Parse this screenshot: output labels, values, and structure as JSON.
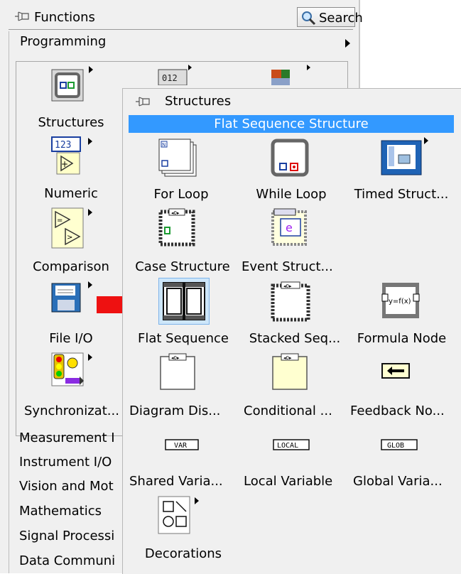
{
  "functions_palette": {
    "title": "Functions",
    "search_label": "Search",
    "programming_label": "Programming",
    "categories": [
      {
        "label": "Structures",
        "icon": "structures-icon"
      },
      {
        "label": "Numeric",
        "icon": "numeric-icon"
      },
      {
        "label": "Comparison",
        "icon": "comparison-icon"
      },
      {
        "label": "File I/O",
        "icon": "file-io-icon"
      },
      {
        "label": "Synchronizat...",
        "icon": "synchronization-icon"
      }
    ],
    "list_items": [
      "Measurement I",
      "Instrument I/O",
      "Vision and Mot",
      "Mathematics",
      "Signal Processi",
      "Data Communi"
    ]
  },
  "structures_palette": {
    "title": "Structures",
    "selected_item_header": "Flat Sequence Structure",
    "items": [
      {
        "label": "For Loop",
        "icon": "for-loop-icon"
      },
      {
        "label": "While Loop",
        "icon": "while-loop-icon"
      },
      {
        "label": "Timed Struct...",
        "icon": "timed-structure-icon"
      },
      {
        "label": "Case Structure",
        "icon": "case-structure-icon"
      },
      {
        "label": "Event Struct...",
        "icon": "event-structure-icon"
      },
      {
        "label": "Flat Sequence",
        "icon": "flat-sequence-icon"
      },
      {
        "label": "Stacked Seq...",
        "icon": "stacked-sequence-icon"
      },
      {
        "label": "Formula Node",
        "icon": "formula-node-icon"
      },
      {
        "label": "Diagram Dis...",
        "icon": "diagram-disable-icon"
      },
      {
        "label": "Conditional ...",
        "icon": "conditional-disable-icon"
      },
      {
        "label": "Feedback No...",
        "icon": "feedback-node-icon"
      },
      {
        "label": "Shared Varia...",
        "icon": "shared-variable-icon"
      },
      {
        "label": "Local Variable",
        "icon": "local-variable-icon"
      },
      {
        "label": "Global Varia...",
        "icon": "global-variable-icon"
      },
      {
        "label": "Decorations",
        "icon": "decorations-icon"
      }
    ],
    "icon_texts": {
      "numeric": "123",
      "shared_var": "VAR",
      "local_var": "LOCAL",
      "global_var": "GLOB",
      "formula": "y=f(x)",
      "event": "e"
    }
  },
  "colors": {
    "selection_blue": "#3399ff",
    "highlight": "#cde6fa",
    "annotation_arrow": "#ee1111",
    "palette_bg": "#f0f0f0"
  }
}
